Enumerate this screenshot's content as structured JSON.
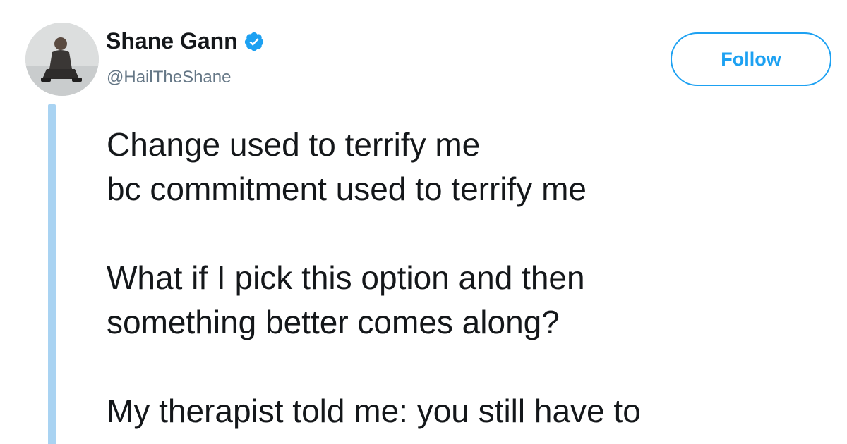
{
  "author": {
    "display_name": "Shane Gann",
    "handle": "@HailTheShane",
    "verified": true,
    "avatar_icon": "profile-photo"
  },
  "follow_button": {
    "label": "Follow"
  },
  "tweet": {
    "lines": [
      "Change used to terrify me",
      "bc commitment used to terrify me",
      "",
      "What if I pick this option and then",
      "something better comes along?",
      "",
      "My therapist told me: you still have to"
    ]
  },
  "colors": {
    "accent": "#1da1f2",
    "thread_line": "#a9d3f2",
    "text": "#14171a",
    "muted": "#657786"
  }
}
